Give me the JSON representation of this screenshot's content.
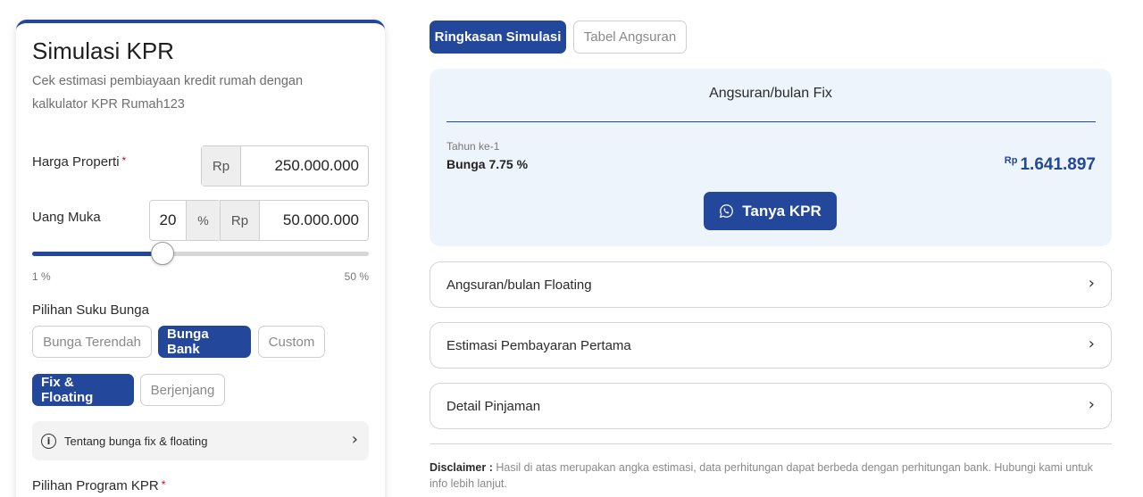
{
  "simulation": {
    "title": "Simulasi KPR",
    "subtitle": "Cek estimasi pembiayaan kredit rumah dengan kalkulator KPR Rumah123",
    "price_label": "Harga Properti",
    "required_mark": "*",
    "currency_prefix": "Rp",
    "price_value": "250.000.000",
    "dp_label": "Uang Muka",
    "dp_percent": "20",
    "percent_symbol": "%",
    "dp_value": "50.000.000",
    "slider_min_label": "1 %",
    "slider_max_label": "50 %",
    "slider_value_percent": 20,
    "slider_min": 1,
    "slider_max": 50,
    "rate_option_label": "Pilihan Suku Bunga",
    "rate_options": [
      "Bunga Terendah",
      "Bunga Bank",
      "Custom"
    ],
    "rate_selected": "Bunga Bank",
    "rate_types": [
      "Fix & Floating",
      "Berjenjang"
    ],
    "rate_type_selected": "Fix & Floating",
    "info_text": "Tentang bunga fix & floating",
    "program_label": "Pilihan Program KPR"
  },
  "tabs": {
    "summary": "Ringkasan Simulasi",
    "schedule": "Tabel Angsuran"
  },
  "summary": {
    "title": "Angsuran/bulan Fix",
    "year_label": "Tahun ke-1",
    "rate_label": "Bunga 7.75 %",
    "currency": "Rp",
    "amount": "1.641.897",
    "cta_label": "Tanya KPR"
  },
  "accordions": [
    {
      "label": "Angsuran/bulan Floating"
    },
    {
      "label": "Estimasi Pembayaran Pertama"
    },
    {
      "label": "Detail Pinjaman"
    }
  ],
  "disclaimer": {
    "label": "Disclaimer :",
    "text": "Hasil di atas merupakan angka estimasi, data perhitungan dapat berbeda dengan perhitungan bank. Hubungi kami untuk info lebih lanjut."
  },
  "colors": {
    "primary": "#23479a",
    "summary_bg": "#eef4fc",
    "required": "#d0021b"
  }
}
